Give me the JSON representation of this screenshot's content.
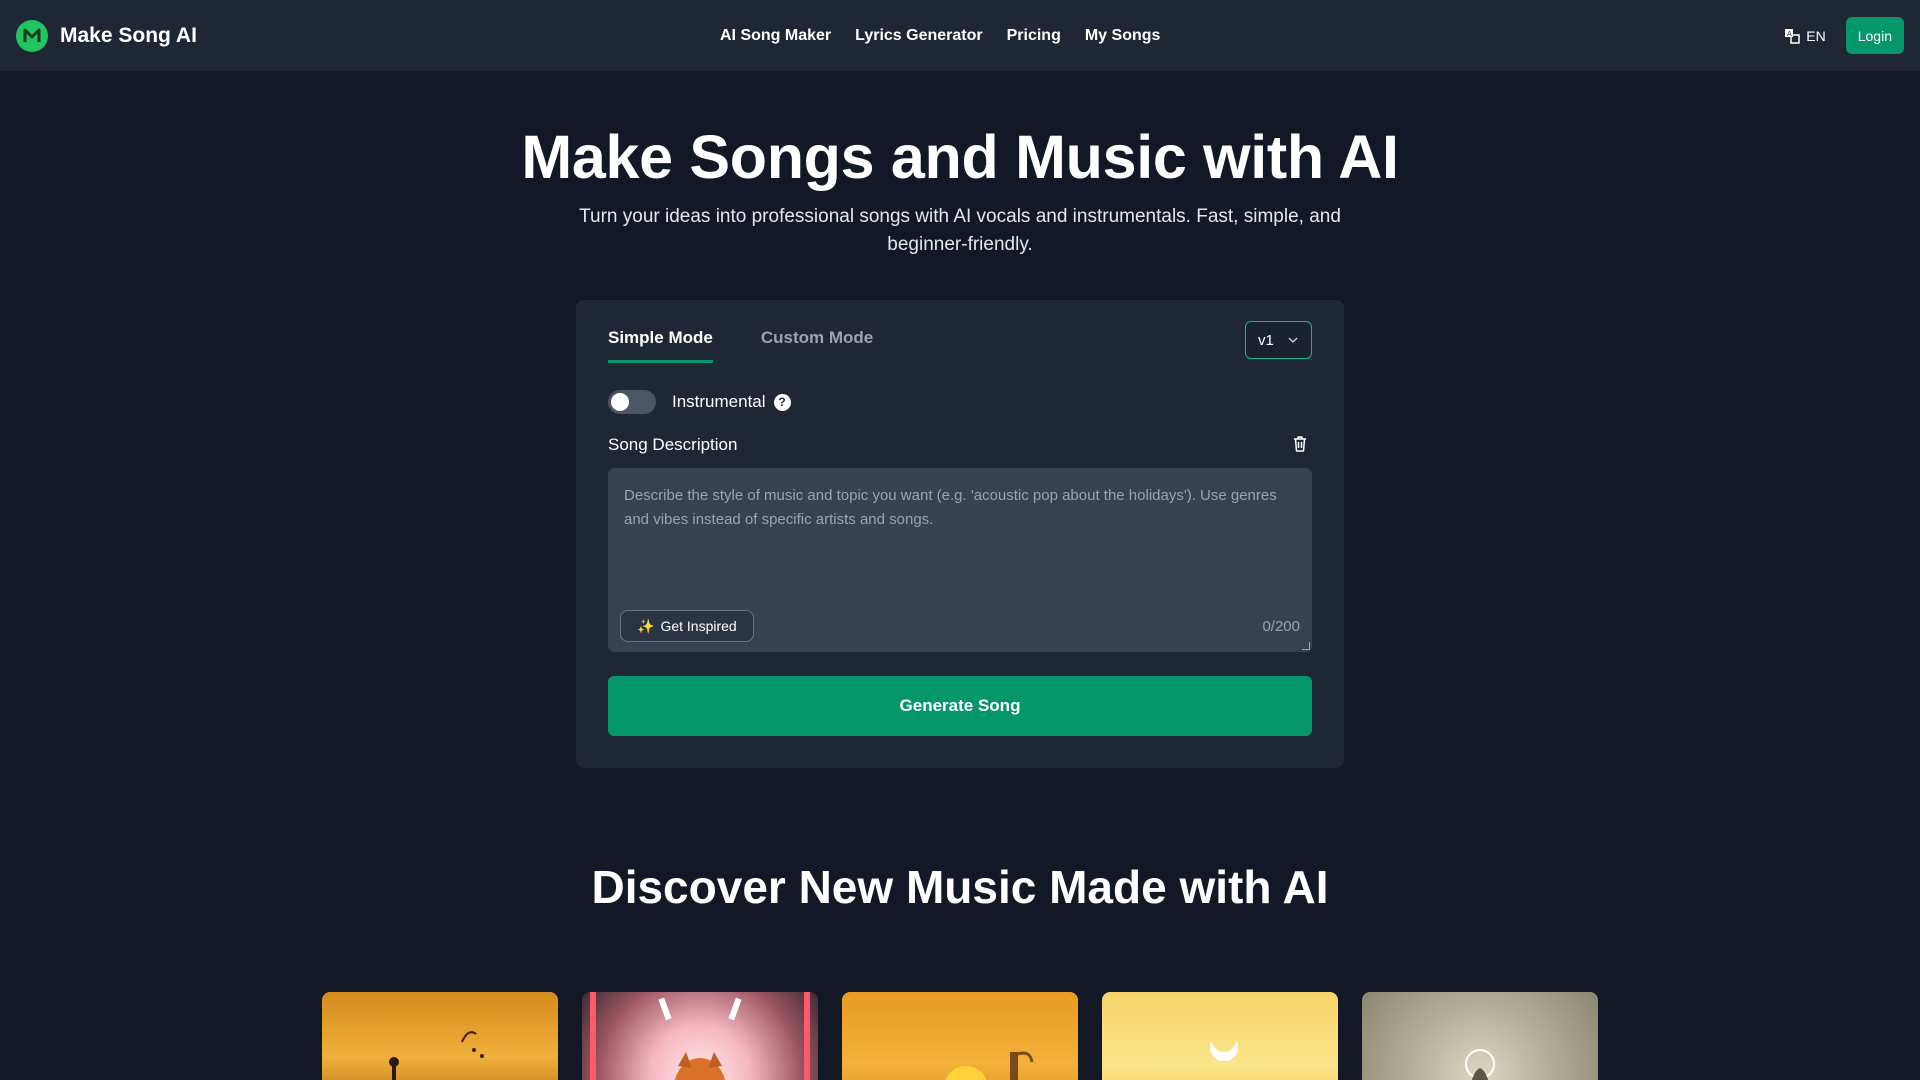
{
  "brand": {
    "name": "Make Song AI",
    "logo_letter": "M",
    "color": "#22c55e"
  },
  "nav": {
    "items": [
      {
        "label": "AI Song Maker"
      },
      {
        "label": "Lyrics Generator"
      },
      {
        "label": "Pricing"
      },
      {
        "label": "My Songs"
      }
    ]
  },
  "header": {
    "language": "EN",
    "login_label": "Login"
  },
  "hero": {
    "title": "Make Songs and Music with AI",
    "subtitle": "Turn your ideas into professional songs with AI vocals and instrumentals. Fast, simple, and beginner-friendly."
  },
  "form": {
    "tabs": [
      {
        "label": "Simple Mode",
        "active": true
      },
      {
        "label": "Custom Mode",
        "active": false
      }
    ],
    "version": "v1",
    "instrumental_label": "Instrumental",
    "instrumental_on": false,
    "description_label": "Song Description",
    "description_value": "",
    "description_placeholder": "Describe the style of music and topic you want (e.g. 'acoustic pop about the holidays'). Use genres and vibes instead of specific artists and songs.",
    "inspire_label": "Get Inspired",
    "counter": "0/200",
    "generate_label": "Generate Song"
  },
  "discover": {
    "title": "Discover New Music Made with AI",
    "thumbnails": [
      "thumb-sunset-musician",
      "thumb-cat-neon",
      "thumb-sunset-guitar",
      "thumb-moon-figure",
      "thumb-bell-figure"
    ]
  },
  "colors": {
    "accent": "#059669",
    "background": "#121826",
    "card": "#1f2735"
  }
}
